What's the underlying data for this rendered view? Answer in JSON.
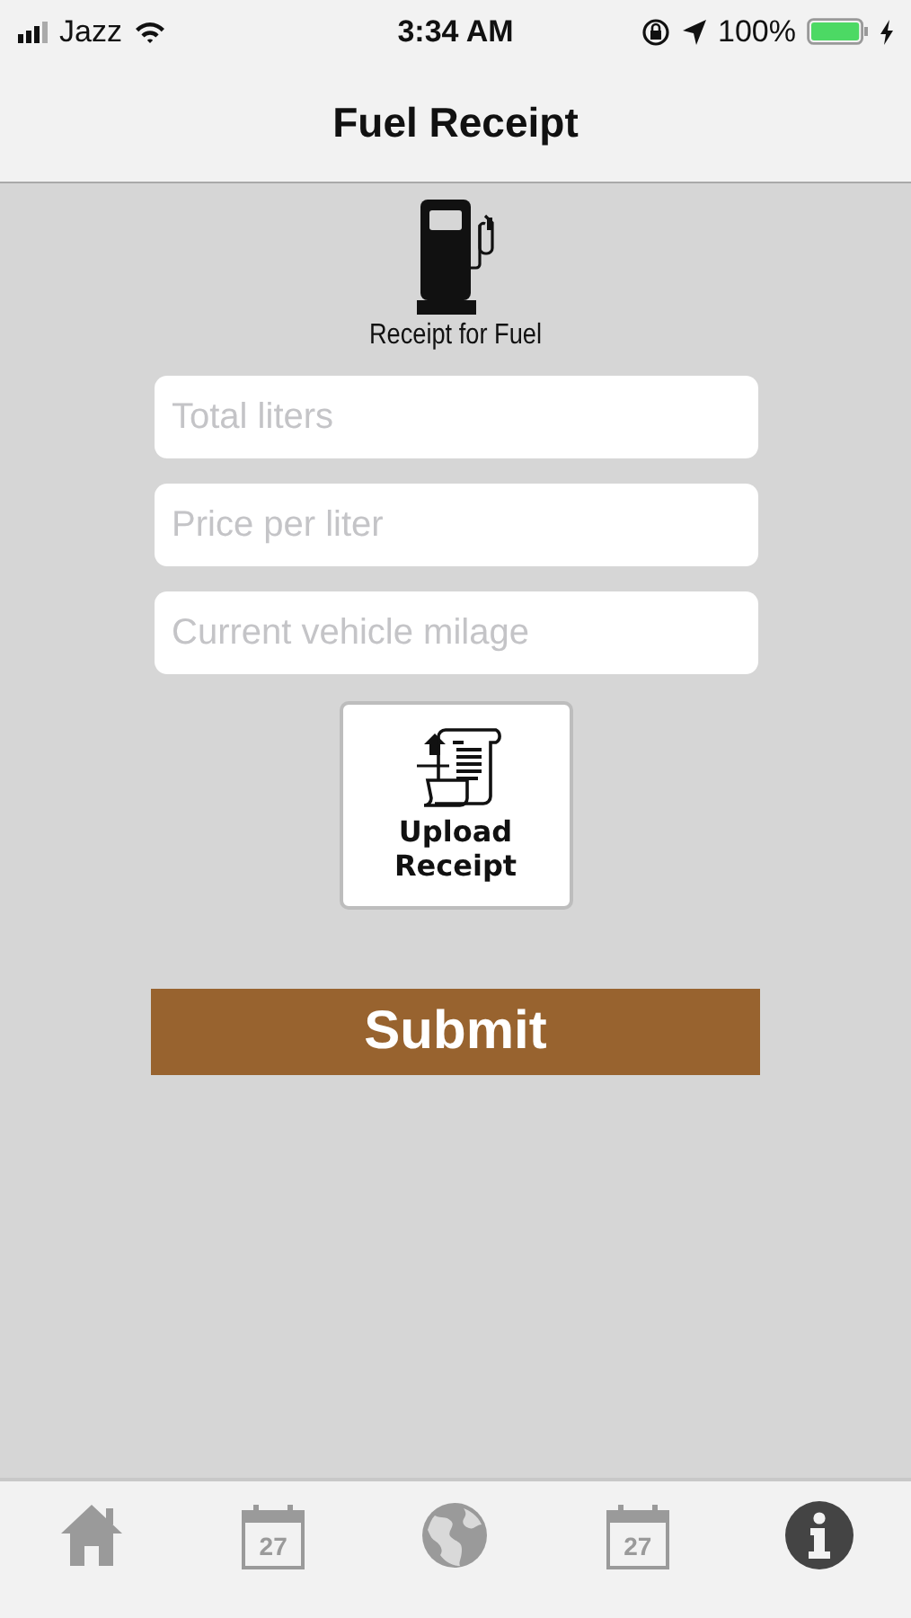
{
  "status_bar": {
    "carrier": "Jazz",
    "time": "3:34 AM",
    "battery": "100%"
  },
  "nav_bar": {
    "title": "Fuel Receipt"
  },
  "header": {
    "caption": "Receipt for Fuel"
  },
  "fields": [
    {
      "placeholder": "Total liters"
    },
    {
      "placeholder": "Price per liter"
    },
    {
      "placeholder": "Current vehicle milage"
    }
  ],
  "upload_button": {
    "label": "Upload Receipt"
  },
  "submit_button": {
    "label": "Submit"
  },
  "tab_bar": [
    {
      "kind": "home",
      "selected": false
    },
    {
      "kind": "calendar",
      "day": "27",
      "selected": false
    },
    {
      "kind": "globe",
      "selected": false
    },
    {
      "kind": "calendar",
      "day": "27",
      "selected": false
    },
    {
      "kind": "info",
      "selected": true
    }
  ]
}
